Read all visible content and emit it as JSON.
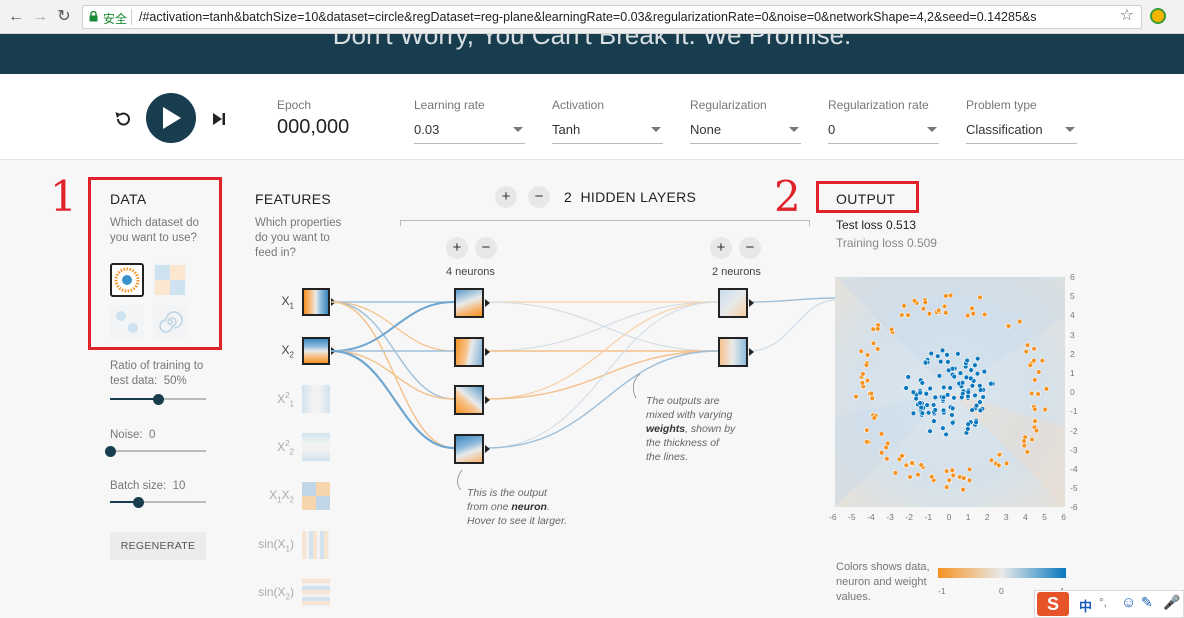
{
  "browser": {
    "secure_label": "安全",
    "url": "/#activation=tanh&batchSize=10&dataset=circle&regDataset=reg-plane&learningRate=0.03&regularizationRate=0&noise=0&networkShape=4,2&seed=0.14285&s"
  },
  "header": {
    "tagline": "Don't Worry, You Can't Break It. We Promise."
  },
  "controls": {
    "epoch_label": "Epoch",
    "epoch_value": "000,000",
    "learning_rate": {
      "label": "Learning rate",
      "value": "0.03"
    },
    "activation": {
      "label": "Activation",
      "value": "Tanh"
    },
    "regularization": {
      "label": "Regularization",
      "value": "None"
    },
    "regularization_rate": {
      "label": "Regularization rate",
      "value": "0"
    },
    "problem_type": {
      "label": "Problem type",
      "value": "Classification"
    }
  },
  "data": {
    "title": "DATA",
    "question": "Which dataset do you want to use?",
    "ratio_label": "Ratio of training to test data:",
    "ratio_value": "50%",
    "ratio_fraction": 0.5,
    "noise_label": "Noise:",
    "noise_value": "0",
    "noise_fraction": 0.0,
    "batch_label": "Batch size:",
    "batch_value": "10",
    "batch_fraction": 0.3,
    "regenerate_label": "REGENERATE"
  },
  "features": {
    "title": "FEATURES",
    "question": "Which properties do you want to feed in?",
    "items": [
      {
        "base": "X",
        "sub": "1",
        "sup": ""
      },
      {
        "base": "X",
        "sub": "2",
        "sup": ""
      },
      {
        "base": "X",
        "sub": "1",
        "sup": "2"
      },
      {
        "base": "X",
        "sub": "2",
        "sup": "2"
      },
      {
        "base": "X",
        "sub": "1",
        "sup": ""
      },
      {
        "base": "sin(X",
        "sub": "1",
        "sup": ""
      },
      {
        "base": "sin(X",
        "sub": "2",
        "sup": ""
      }
    ]
  },
  "network": {
    "hidden_layers_label": "HIDDEN LAYERS",
    "hidden_layers_count": "2",
    "layer1_neurons": "4 neurons",
    "layer2_neurons": "2 neurons",
    "annotation_neuron_1": "This is the output from one",
    "annotation_neuron_bold": "neuron",
    "annotation_neuron_2": ". Hover to see it larger.",
    "annotation_weights_1": "The outputs are mixed with varying",
    "annotation_weights_bold": "weights",
    "annotation_weights_2": ", shown by the thickness of the lines."
  },
  "output": {
    "title": "OUTPUT",
    "test_loss_label": "Test loss",
    "test_loss_value": "0.513",
    "training_loss_label": "Training loss",
    "training_loss_value": "0.509",
    "y_ticks": [
      "6",
      "5",
      "4",
      "3",
      "2",
      "1",
      "0",
      "-1",
      "-2",
      "-3",
      "-4",
      "-5",
      "-6"
    ],
    "x_ticks": [
      "-6",
      "-5",
      "-4",
      "-3",
      "-2",
      "-1",
      "0",
      "1",
      "2",
      "3",
      "4",
      "5",
      "6"
    ],
    "legend_text": "Colors shows data, neuron and weight values.",
    "legend_min": "-1",
    "legend_mid": "0",
    "legend_max": "1",
    "colors": {
      "orange": "#f59322",
      "blue": "#0877bd"
    }
  },
  "annotations": {
    "num1": "1",
    "num2": "2"
  },
  "ime": {
    "label": "中"
  }
}
